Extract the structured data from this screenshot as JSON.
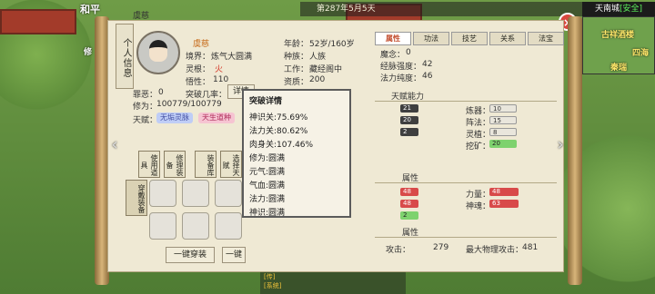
{
  "hud": {
    "left_top": "和平",
    "left_mid": "修",
    "top_ticker": "第287年5月5天",
    "city": "天南城",
    "safety": "[安全]",
    "close": "×"
  },
  "minimap": {
    "label1": "古祥酒楼",
    "label2": "四海",
    "label3": "秦瑞"
  },
  "profile": {
    "vertical_tag": "个人信息",
    "name_above": "虞慈",
    "name": "虞慈",
    "realm_label": "境界：",
    "realm_value": "炼气大圆满",
    "root_label": "灵根：",
    "root_value": "火",
    "comprehension_label": "悟性：",
    "comprehension_value": "110",
    "crime_label": "罪恶：",
    "crime_value": "0",
    "breakthrough_label": "突破几率：",
    "detail_button": "详情",
    "cultivation_label": "修为：",
    "cultivation_value": "100779/100779",
    "talent_label": "天赋：",
    "talent1": "无垢灵脉",
    "talent2": "天生道种",
    "age_label": "年龄：",
    "age_value": "52岁/160岁",
    "race_label": "种族：",
    "race_value": "人族",
    "job_label": "工作：",
    "job_value": "藏经阁中",
    "aptitude_label": "资质：",
    "aptitude_value": "200"
  },
  "tabs": [
    "属性",
    "功法",
    "技艺",
    "关系",
    "法宝"
  ],
  "stats_right": {
    "mind_label": "魔念：",
    "mind_value": "0",
    "meridian_label": "经脉强度：",
    "meridian_value": "42",
    "mana_label": "法力纯度：",
    "mana_value": "46",
    "ability_header": "天赋能力",
    "alchemy_label": "炼器：",
    "alchemy_value": "10",
    "array_label": "阵法：",
    "array_value": "15",
    "spirit_label": "灵植：",
    "spirit_value": "8",
    "mine_label": "挖矿：",
    "mine_value": "20",
    "attr_header": "属性",
    "power_label": "力量：",
    "power_value": "48",
    "spirit2_label": "神魂：",
    "spirit2_value": "63",
    "attr_header2": "属性",
    "atk_label": "攻击：",
    "atk_value": "279",
    "max_atk_label": "最大物理攻击：",
    "max_atk_value": "481"
  },
  "left_bars": [
    "21",
    "20",
    "2",
    "48",
    "48",
    "2"
  ],
  "skills": [
    "使用道具",
    "修理装备",
    "装备库",
    "选择天赋"
  ],
  "equip_label": "穿戴装备",
  "buttons": {
    "wear_all": "一键穿装",
    "unequip": "一键"
  },
  "popup": {
    "title": "突破详情",
    "rows": [
      "神识关:75.69%",
      "法力关:80.62%",
      "肉身关:107.46%",
      "修为:圆满",
      "元气:圆满",
      "气血:圆满",
      "法力:圆满",
      "神识:圆满"
    ]
  },
  "chat": {
    "line1": "[传]",
    "line2": "[系统]"
  }
}
